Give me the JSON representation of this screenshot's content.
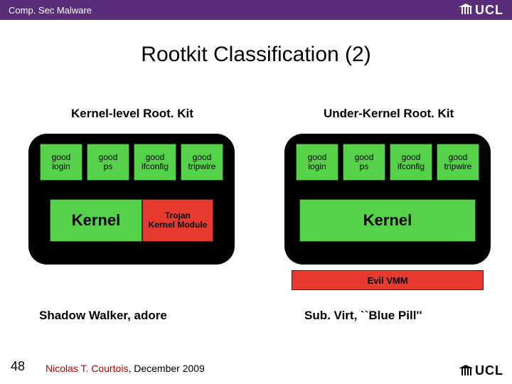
{
  "header": {
    "course": "Comp. Sec Malware",
    "logo_text": "UCL"
  },
  "title": "Rootkit Classification (2)",
  "columns": {
    "left": {
      "heading": "Kernel-level Root. Kit",
      "procs": [
        {
          "l1": "good",
          "l2": "login"
        },
        {
          "l1": "good",
          "l2": "ps"
        },
        {
          "l1": "good",
          "l2": "ifconfig"
        },
        {
          "l1": "good",
          "l2": "tripwire"
        }
      ],
      "kernel_label": "Kernel",
      "trojan_l1": "Trojan",
      "trojan_l2": "Kernel Module",
      "example": "Shadow Walker, adore"
    },
    "right": {
      "heading": "Under-Kernel Root. Kit",
      "procs": [
        {
          "l1": "good",
          "l2": "login"
        },
        {
          "l1": "good",
          "l2": "ps"
        },
        {
          "l1": "good",
          "l2": "ifconfig"
        },
        {
          "l1": "good",
          "l2": "tripwire"
        }
      ],
      "kernel_label": "Kernel",
      "evil_vmm": "Evil VMM",
      "example": "Sub. Virt, ``Blue Pill''"
    }
  },
  "footer": {
    "page": "48",
    "author": "Nicolas T. Courtois",
    "date": ", December 2009",
    "logo_text": "UCL"
  }
}
